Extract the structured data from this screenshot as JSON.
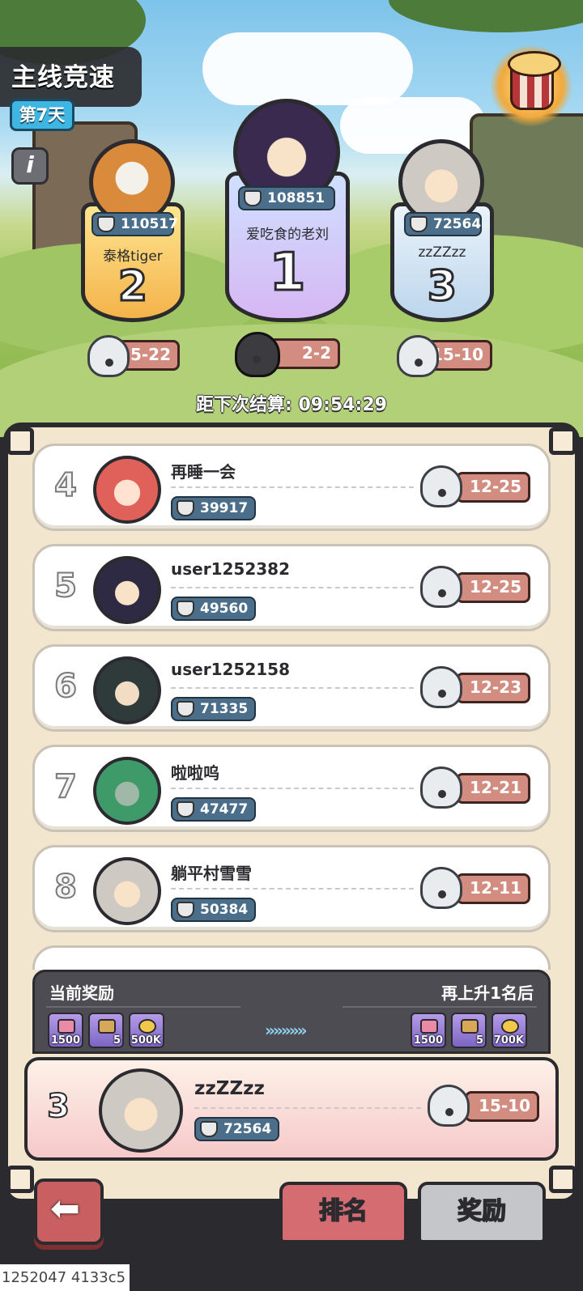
{
  "header": {
    "title": "主线竞速",
    "day": "第7天",
    "info_icon": "info-icon",
    "chest_icon": "gift-chest-icon"
  },
  "podium": [
    {
      "rank": "2",
      "name": "泰格tiger",
      "power": "110517",
      "stage": "15-22"
    },
    {
      "rank": "1",
      "name": "爱吃食的老刘",
      "power": "108851",
      "stage": "2-2"
    },
    {
      "rank": "3",
      "name": "zzZZzz",
      "power": "72564",
      "stage": "15-10"
    }
  ],
  "timer": {
    "text": "距下次结算: 09:54:29"
  },
  "list": [
    {
      "rank": "4",
      "name": "再睡一会",
      "power": "39917",
      "stage": "12-25"
    },
    {
      "rank": "5",
      "name": "user1252382",
      "power": "49560",
      "stage": "12-25"
    },
    {
      "rank": "6",
      "name": "user1252158",
      "power": "71335",
      "stage": "12-23"
    },
    {
      "rank": "7",
      "name": "啦啦呜",
      "power": "47477",
      "stage": "12-21"
    },
    {
      "rank": "8",
      "name": "躺平村雪雪",
      "power": "50384",
      "stage": "12-11"
    }
  ],
  "rewards": {
    "current_label": "当前奖励",
    "next_label": "再上升1名后",
    "current_items": [
      {
        "count": "1500"
      },
      {
        "count": "5"
      },
      {
        "count": "500K"
      }
    ],
    "next_items": [
      {
        "count": "1500"
      },
      {
        "count": "5"
      },
      {
        "count": "700K"
      }
    ],
    "arrows": "»»»»»"
  },
  "me": {
    "rank": "3",
    "name": "zzZZzz",
    "power": "72564",
    "stage": "15-10"
  },
  "tabs": {
    "rank": "排名",
    "reward": "奖励"
  },
  "footer": {
    "id": "1252047 4133c5"
  },
  "colors": {
    "accent_red": "#d46c72",
    "power_bg": "#4b6e8a",
    "stage_bg": "#d28c80",
    "day_badge": "#3fb6e2"
  }
}
